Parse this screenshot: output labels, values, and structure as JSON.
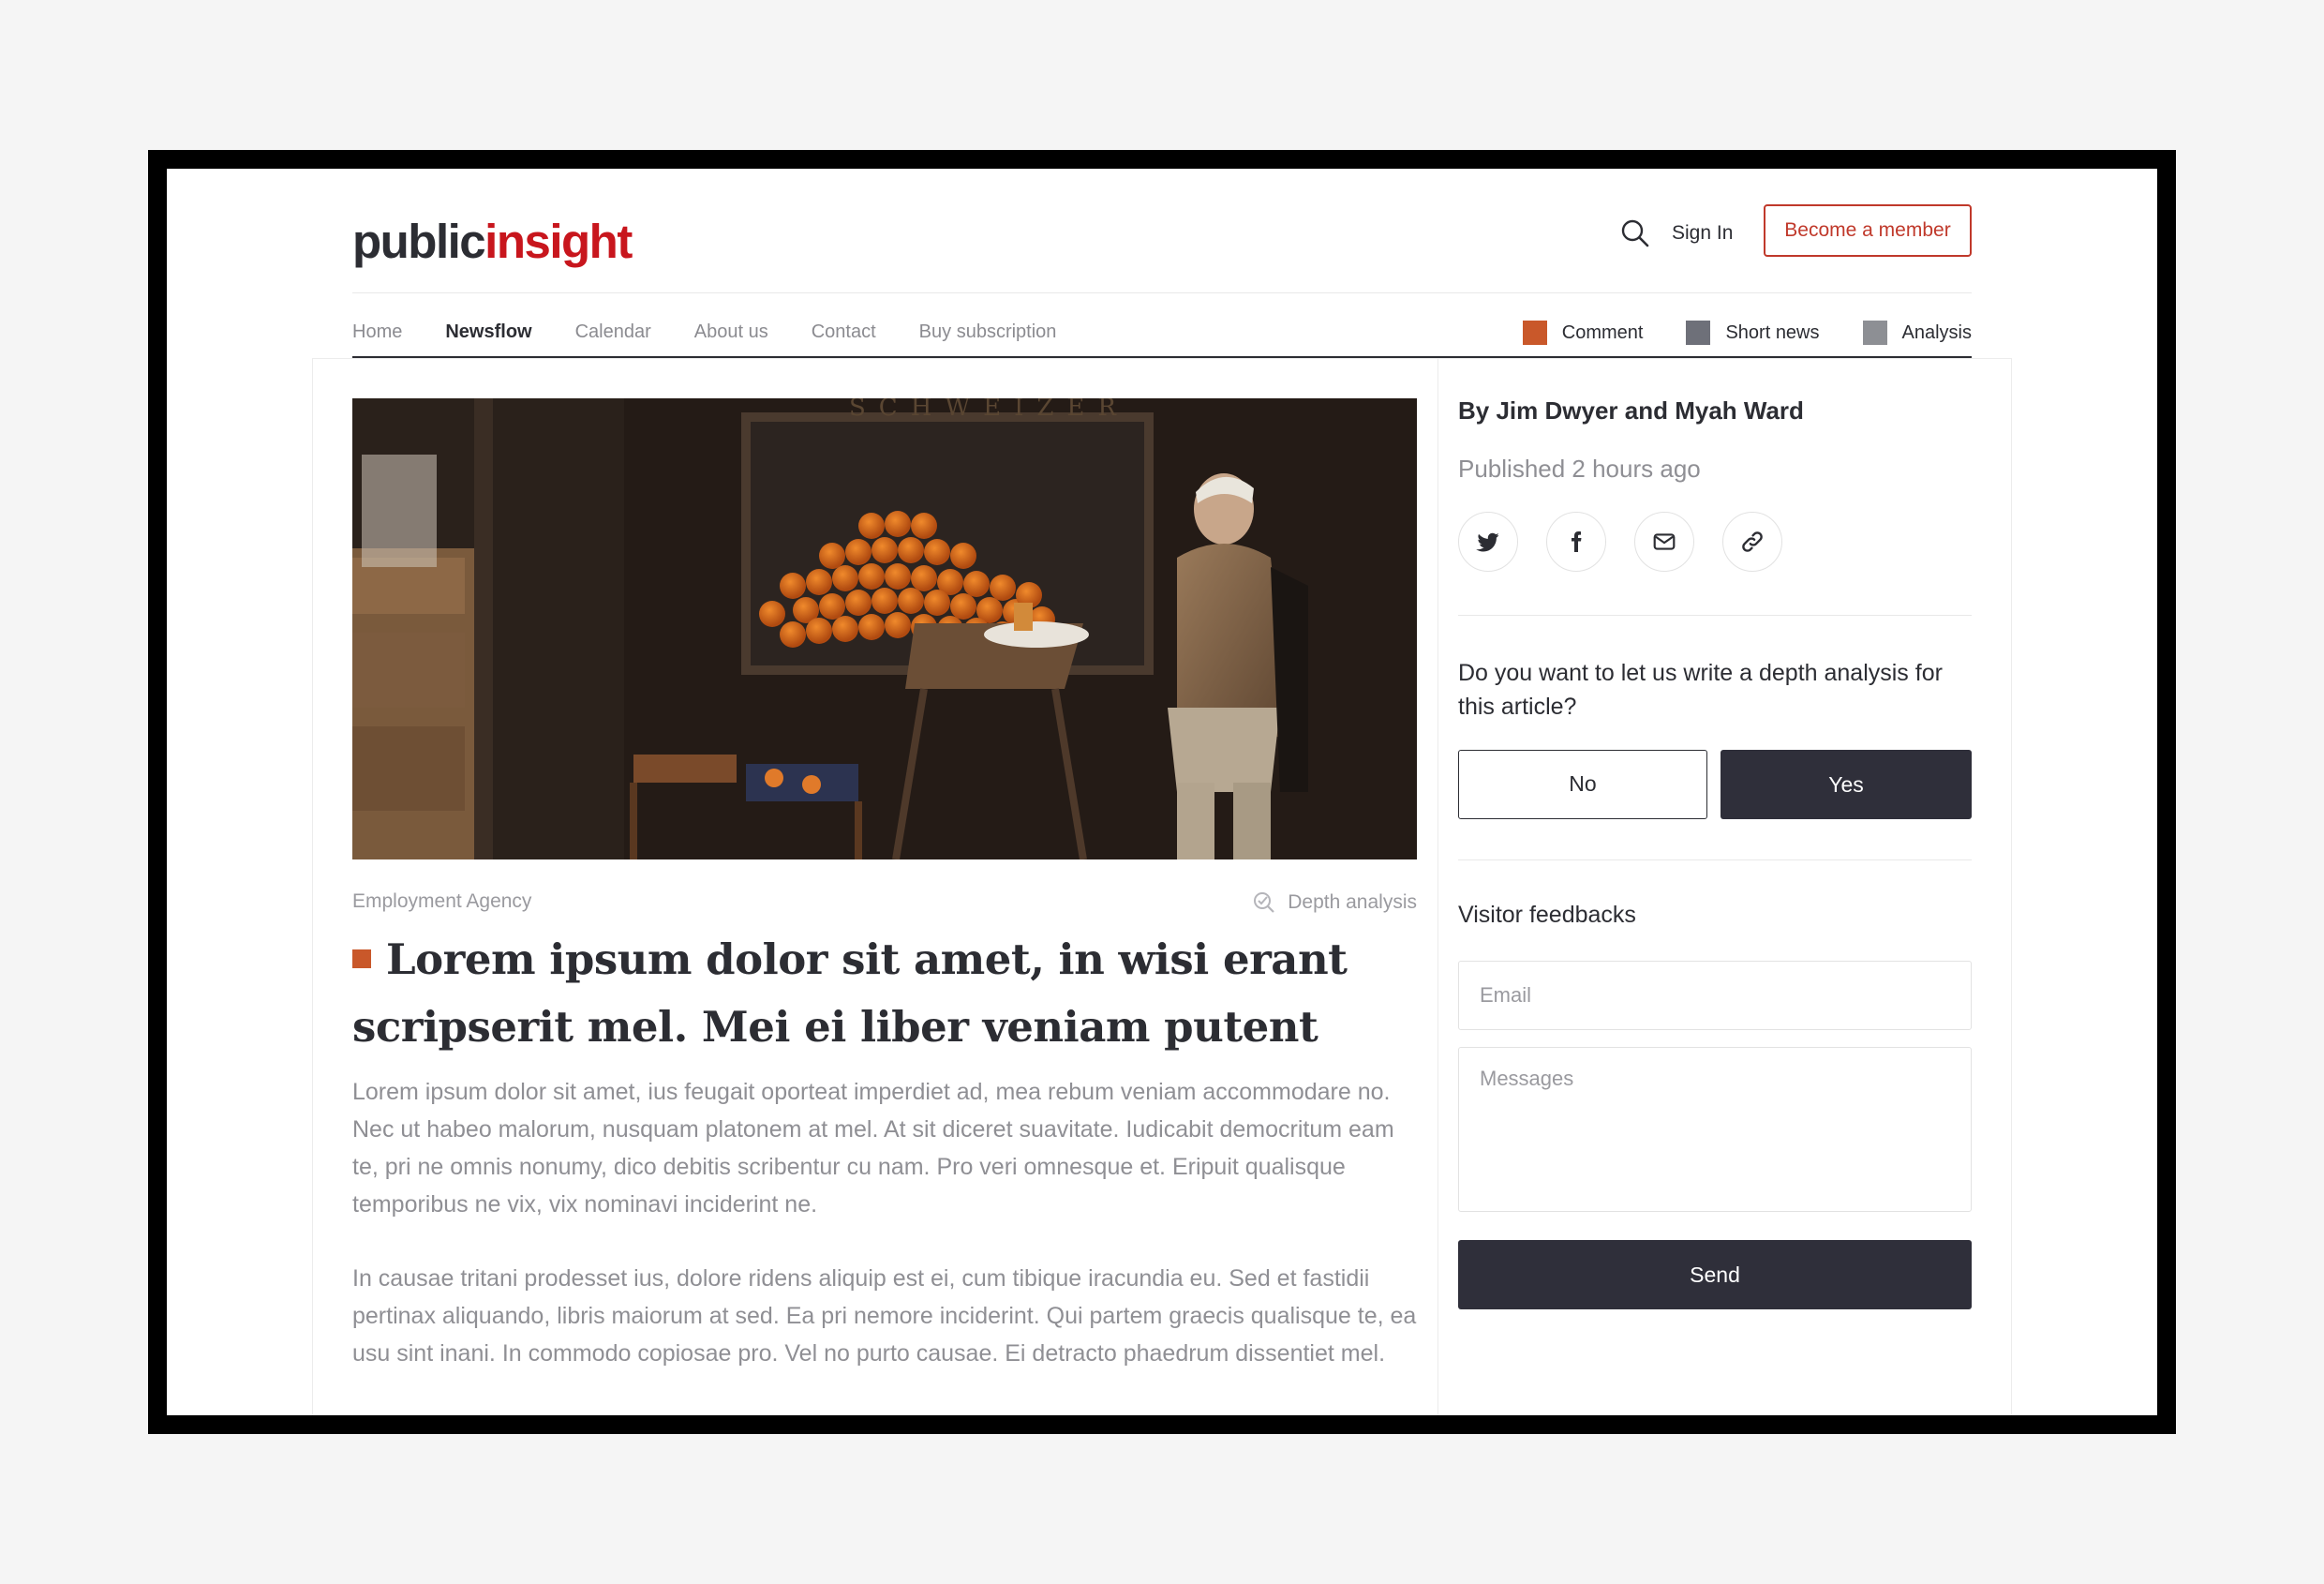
{
  "brand": {
    "part1": "public",
    "part2": "insight",
    "color_primary": "#c8161d"
  },
  "header": {
    "signin_label": "Sign In",
    "member_label": "Become a member"
  },
  "nav": {
    "items": [
      {
        "label": "Home",
        "active": false
      },
      {
        "label": "Newsflow",
        "active": true
      },
      {
        "label": "Calendar",
        "active": false
      },
      {
        "label": "About us",
        "active": false
      },
      {
        "label": "Contact",
        "active": false
      },
      {
        "label": "Buy subscription",
        "active": false
      }
    ],
    "legend": [
      {
        "label": "Comment",
        "color": "#c9582a"
      },
      {
        "label": "Short news",
        "color": "#6e7079"
      },
      {
        "label": "Analysis",
        "color": "#8d8f94"
      }
    ]
  },
  "article": {
    "category": "Employment Agency",
    "depth_label": "Depth analysis",
    "title": "Lorem ipsum dolor sit amet, in wisi erant scripserit mel. Mei ei liber veniam putent",
    "paragraphs": [
      "Lorem ipsum dolor sit amet, ius feugait oporteat imperdiet ad, mea rebum veniam accommodare no. Nec ut habeo malorum, nusquam platonem at mel. At sit diceret suavitate. Iudicabit democritum eam te, pri ne omnis nonumy, dico debitis scribentur cu nam. Pro veri omnesque et. Eripuit qualisque temporibus ne vix, vix nominavi inciderint ne.",
      "In causae tritani prodesset ius, dolore ridens aliquip est ei, cum tibique iracundia eu. Sed et fastidii pertinax aliquando, libris maiorum at sed. Ea pri nemore inciderint. Qui partem graecis qualisque te, ea usu sint inani. In commodo copiosae pro. Vel no purto causae. Ei detracto phaedrum dissentiet mel."
    ],
    "image_sign_text": "SCHWEIZER"
  },
  "sidebar": {
    "byline": "By Jim Dwyer and Myah Ward",
    "published": "Published 2 hours ago",
    "share_icons": [
      "twitter-icon",
      "facebook-icon",
      "mail-icon",
      "link-icon"
    ],
    "question": "Do you want to let us write a depth analysis for this article?",
    "no_label": "No",
    "yes_label": "Yes",
    "feedback_title": "Visitor feedbacks",
    "email_placeholder": "Email",
    "messages_placeholder": "Messages",
    "send_label": "Send"
  }
}
